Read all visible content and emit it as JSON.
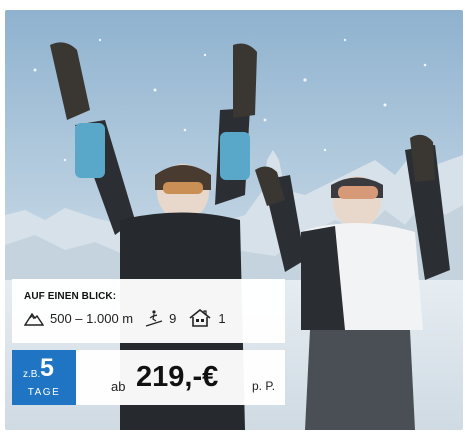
{
  "offer": {
    "glance_title": "AUF EINEN BLICK:",
    "altitude": "500 – 1.000 m",
    "lifts": "9",
    "accommodations": "1",
    "days_prefix": "z.B.",
    "days_number": "5",
    "days_unit": "TAGE",
    "price_prefix": "ab",
    "price_value": "219,-€",
    "price_suffix": "p. P."
  },
  "icons": {
    "altitude": "mountain-icon",
    "lifts": "ski-lift-icon",
    "accommodations": "house-icon"
  },
  "colors": {
    "accent_blue": "#1f75c4"
  }
}
